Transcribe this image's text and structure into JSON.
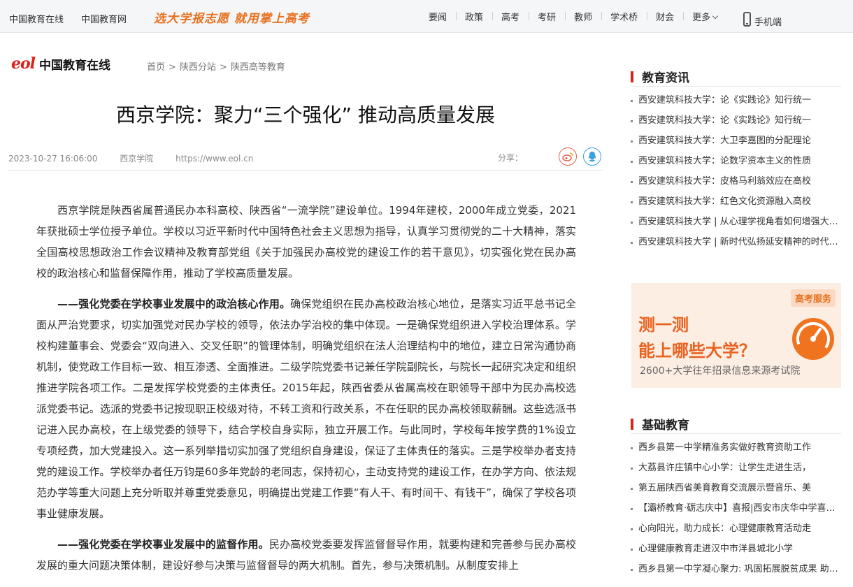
{
  "topbar": {
    "links": [
      "中国教育在线",
      "中国教育网"
    ],
    "slogan": "选大学报志愿 就用掌上高考",
    "nav": [
      "要闻",
      "政策",
      "高考",
      "考研",
      "教师",
      "学术桥",
      "财会",
      "更多"
    ],
    "mobile_label": "手机端"
  },
  "header": {
    "logo_mark": "eol",
    "logo_text": "中国教育在线",
    "breadcrumb": [
      "首页",
      "陕西分站",
      "陕西高等教育"
    ],
    "breadcrumb_sep": ">"
  },
  "article": {
    "title": "西京学院：聚力“三个强化” 推动高质量发展",
    "date": "2023-10-27 16:06:00",
    "source": "西京学院",
    "url": "https://www.eol.cn",
    "share_label": "分享：",
    "paragraphs": [
      {
        "lead": "",
        "text": "西京学院是陕西省属普通民办本科高校、陕西省“一流学院”建设单位。1994年建校，2000年成立党委，2021年获批硕士学位授予单位。学校以习近平新时代中国特色社会主义思想为指导，认真学习贯彻党的二十大精神，落实全国高校思想政治工作会议精神及教育部党组《关于加强民办高校党的建设工作的若干意见》，切实强化党在民办高校的政治核心和监督保障作用，推动了学校高质量发展。"
      },
      {
        "lead": "——强化党委在学校事业发展中的政治核心作用。",
        "text": "确保党组织在民办高校政治核心地位，是落实习近平总书记全面从严治党要求，切实加强党对民办学校的领导，依法办学治校的集中体现。一是确保党组织进入学校治理体系。学校构建董事会、党委会“双向进入、交叉任职”的管理体制，明确党组织在法人治理结构中的地位，建立日常沟通协商机制，使党政工作目标一致、相互渗透、全面推进。二级学院党委书记兼任学院副院长，与院长一起研究决定和组织推进学院各项工作。二是发挥学校党委的主体责任。2015年起，陕西省委从省属高校在职领导干部中为民办高校选派党委书记。选派的党委书记按现职正校级对待，不转工资和行政关系，不在任职的民办高校领取薪酬。这些选派书记进入民办高校，在上级党委的领导下，结合学校自身实际，独立开展工作。与此同时，学校每年按学费的1%设立专项经费，加大党建投入。这一系列举措切实加强了党组织自身建设，保证了主体责任的落实。三是学校举办者支持党的建设工作。学校举办者任万钧是60多年党龄的老同志，保持初心，主动支持党的建设工作，在办学方向、依法规范办学等重大问题上充分听取并尊重党委意见，明确提出党建工作要“有人干、有时间干、有钱干”，确保了学校各项事业健康发展。"
      },
      {
        "lead": "——强化党委在学校事业发展中的监督作用。",
        "text": "民办高校党委要发挥监督督导作用，就要构建和完善参与民办高校发展的重大问题决策体制，建设好参与决策与监督督导的两大机制。首先，参与决策机制。从制度安排上"
      }
    ]
  },
  "sidebar": {
    "news_title": "教育资讯",
    "news": [
      "西安建筑科技大学：论《实践论》知行统一",
      "西安建筑科技大学：论《实践论》知行统一",
      "西安建筑科技大学：大卫李嘉图的分配理论",
      "西安建筑科技大学：论数字资本主义的性质",
      "西安建筑科技大学：皮格马利翁效应在高校",
      "西安建筑科技大学：红色文化资源融入高校",
      "西安建筑科技大学 | 从心理学视角看如何增强大学生",
      "西安建筑科技大学 | 新时代弘扬延安精神的时代价值"
    ],
    "ad": {
      "tag": "高考服务",
      "line1": "测一测",
      "line2": "能上哪些大学？",
      "sub": "2600+大学往年招录信息来源考试院"
    },
    "basic_title": "基础教育",
    "basic": [
      "西乡县第一中学精准务实做好教育资助工作",
      "大荔县许庄镇中心小学：让学生走进生活，",
      "第五届陕西省美育教育交流展示暨音乐、美",
      "【灞桥教育·砺志庆中】喜报|西安市庆华中学喜获佳绩",
      "心向阳光，助力成长：心理健康教育活动走",
      "心理健康教育走进汉中市洋县城北小学",
      "西乡县第一中学凝心聚力: 巩固拓展脱贫成果 助推乡村振兴"
    ]
  },
  "colors": {
    "brand_red": "#d9241c",
    "accent_orange": "#e8711f",
    "ad_background": "#fdeee4"
  }
}
